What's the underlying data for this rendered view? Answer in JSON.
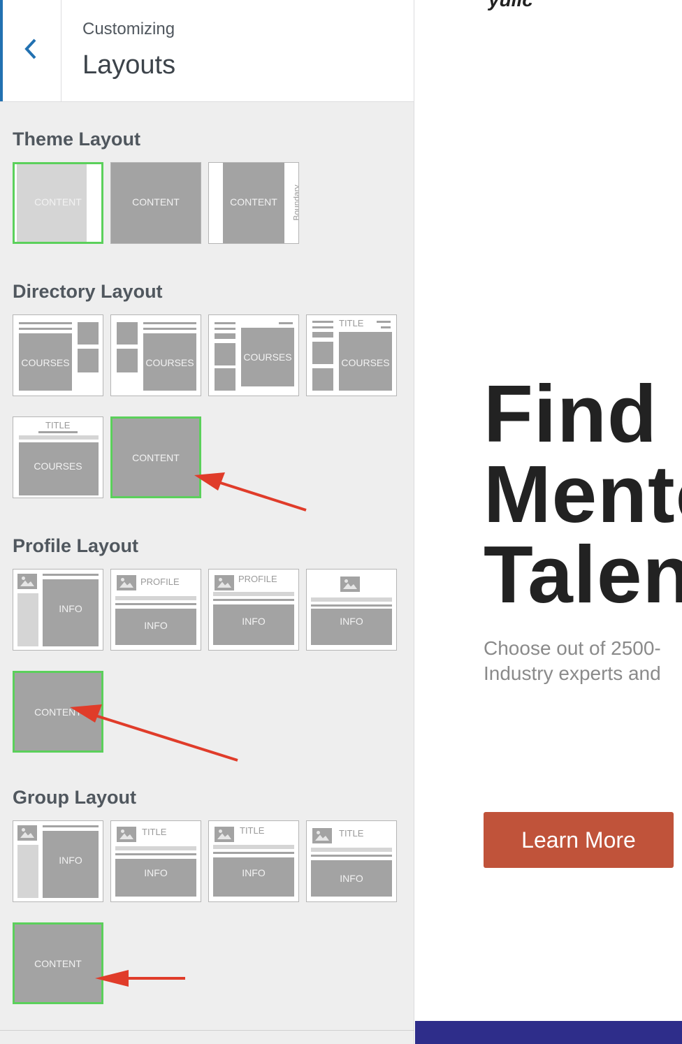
{
  "header": {
    "subtitle": "Customizing",
    "title": "Layouts"
  },
  "sections": {
    "theme": "Theme Layout",
    "directory": "Directory Layout",
    "profile": "Profile Layout",
    "group": "Group Layout"
  },
  "tiles": {
    "content": "CONTENT",
    "courses": "COURSES",
    "title": "TITLE",
    "info": "INFO",
    "profile": "PROFILE",
    "boundary": "Boundary"
  },
  "preview": {
    "logo": "ӯӣііс",
    "headline": [
      "Find c",
      "Mento",
      "Talen"
    ],
    "subtext": [
      "Choose out of 2500-",
      "Industry experts and"
    ],
    "cta": "Learn More"
  },
  "colors": {
    "selected": "#5bd05b",
    "accent": "#2271b1",
    "cta": "#c0533a",
    "arrow": "#e03c2a",
    "footer": "#2e2d8a"
  }
}
